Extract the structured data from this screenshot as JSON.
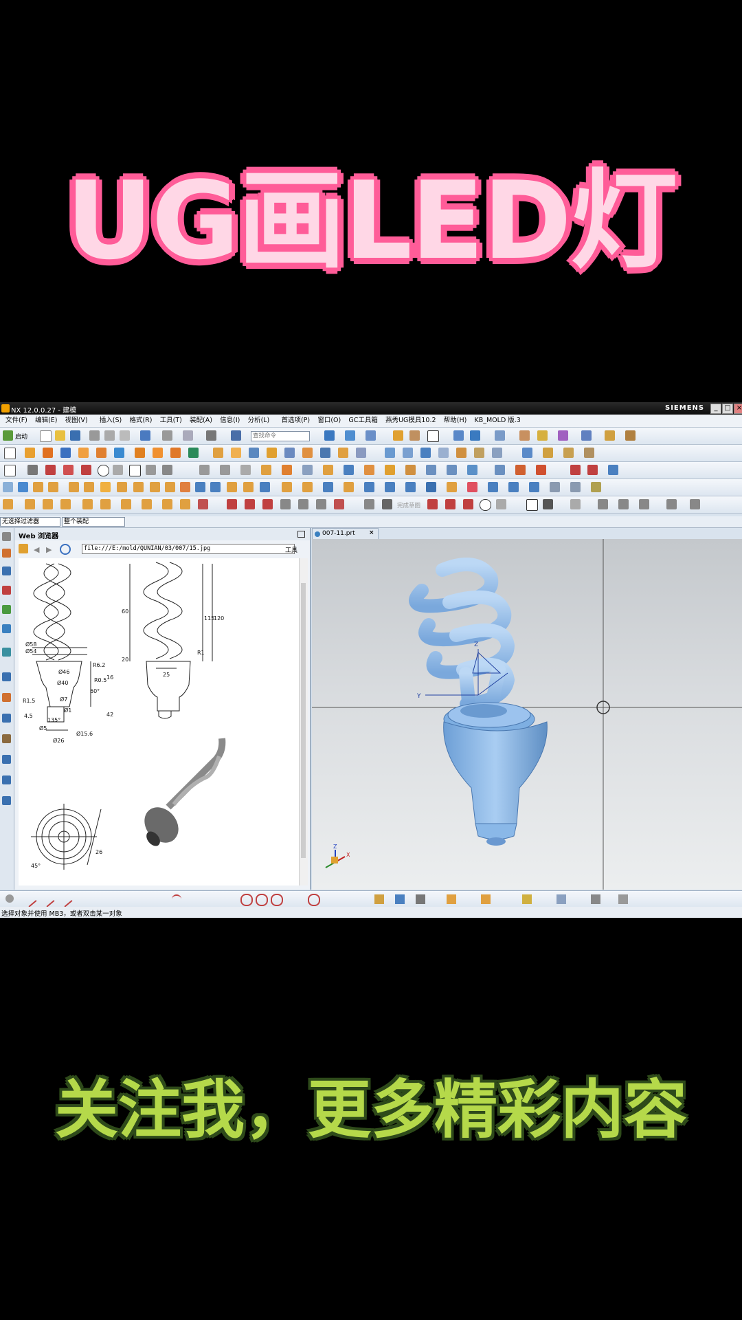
{
  "captions": {
    "title": "UG画LED灯",
    "follow": "关注我，更多精彩内容"
  },
  "window": {
    "title": "NX 12.0.0.27 - 建模",
    "brand": "SIEMENS",
    "buttons": [
      "_",
      "□",
      "×"
    ]
  },
  "menu": [
    "文件(F)",
    "编辑(E)",
    "视图(V)",
    "插入(S)",
    "格式(R)",
    "工具(T)",
    "装配(A)",
    "信息(I)",
    "分析(L)",
    "首选项(P)",
    "窗口(O)",
    "GC工具箱",
    "燕秀UG模具10.2",
    "帮助(H)",
    "KB_MOLD 版.3"
  ],
  "toolbar": {
    "start_label": "启动",
    "command_search_placeholder": "查找命令",
    "sketch_label": "完成草图"
  },
  "filter": {
    "selection_filter": "无选择过滤器",
    "assembly_scope": "整个装配"
  },
  "browser": {
    "title": "Web 浏览器",
    "url": "file:///E:/mold/QUNIAN/03/007/15.jpg",
    "tools_label": "工具"
  },
  "drawing": {
    "dims_left": [
      "Ø58",
      "Ø54",
      "Ø46",
      "Ø40",
      "Ø7",
      "Ø15.6",
      "Ø26",
      "R6.2",
      "R1.5",
      "R0.5",
      "45°",
      "60°",
      "Ø1",
      "Ø5",
      "16",
      "42",
      "135°",
      "26",
      "4.5"
    ],
    "dims_right": [
      "115",
      "120",
      "60",
      "20",
      "25",
      "R1"
    ]
  },
  "graphics": {
    "tab_label": "007-11.prt",
    "triad_y": "Y",
    "triad_z": "Z",
    "triad_x": "X"
  },
  "status": {
    "message": "选择对象并使用 MB3，或者双击某一对象"
  },
  "colors": {
    "title_fill": "#ffd7e6",
    "title_outline": "#ff5c98",
    "follow_fill": "#b5d94a",
    "follow_outline": "#2e4a1a",
    "model_blue": "#8ab8e8"
  }
}
